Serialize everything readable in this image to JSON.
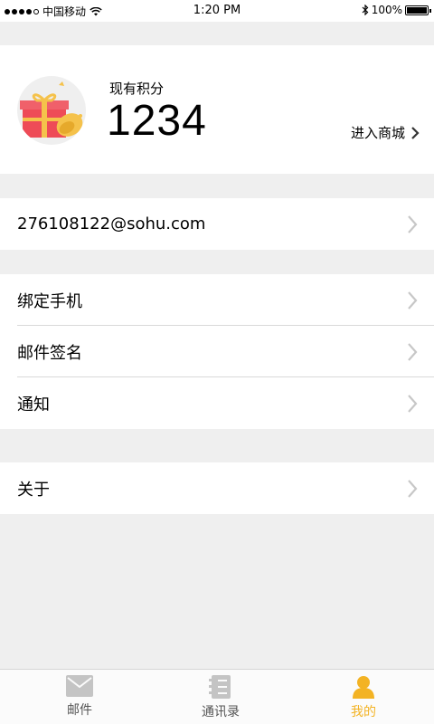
{
  "status_bar": {
    "carrier": "中国移动",
    "time": "1:20 PM",
    "battery": "100%"
  },
  "points": {
    "label": "现有积分",
    "value": "1234",
    "mall_link": "进入商城"
  },
  "account": {
    "email": "276108122@sohu.com"
  },
  "settings": {
    "items": [
      {
        "label": "绑定手机"
      },
      {
        "label": "邮件签名"
      },
      {
        "label": "通知"
      }
    ]
  },
  "about": {
    "label": "关于"
  },
  "tabbar": {
    "tabs": [
      {
        "label": "邮件",
        "icon": "mail-icon"
      },
      {
        "label": "通讯录",
        "icon": "contacts-icon"
      },
      {
        "label": "我的",
        "icon": "profile-icon"
      }
    ],
    "active_color": "#f3b324"
  }
}
